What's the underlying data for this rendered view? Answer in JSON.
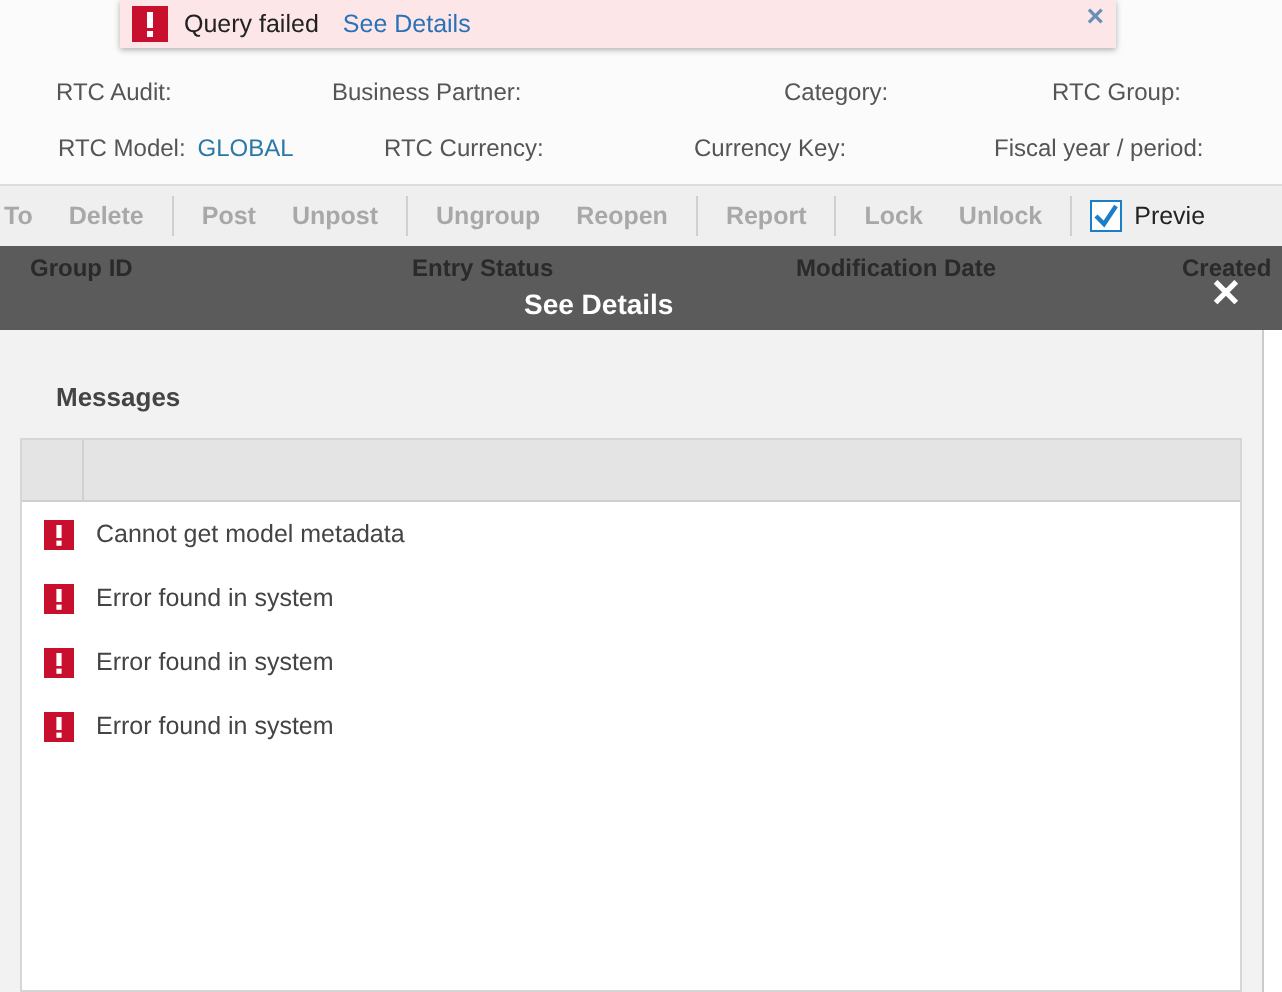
{
  "toast": {
    "message": "Query failed",
    "link": "See Details",
    "close": "×"
  },
  "filters": [
    [
      {
        "label": "RTC Audit:"
      },
      {
        "label": "Business Partner:"
      },
      {
        "label": "Category:"
      },
      {
        "label": "RTC Group:"
      }
    ],
    [
      {
        "label": "RTC Model:",
        "value": "GLOBAL"
      },
      {
        "label": "RTC Currency:"
      },
      {
        "label": "Currency Key:"
      },
      {
        "label": "Fiscal year / period:"
      }
    ]
  ],
  "toolbar": {
    "groups": [
      [
        {
          "label": "To",
          "disabled": true
        },
        {
          "label": "Delete",
          "disabled": true
        }
      ],
      [
        {
          "label": "Post",
          "disabled": true
        },
        {
          "label": "Unpost",
          "disabled": true
        }
      ],
      [
        {
          "label": "Ungroup",
          "disabled": true
        },
        {
          "label": "Reopen",
          "disabled": true
        }
      ],
      [
        {
          "label": "Report",
          "disabled": true
        }
      ],
      [
        {
          "label": "Lock",
          "disabled": true
        },
        {
          "label": "Unlock",
          "disabled": true
        }
      ]
    ],
    "checkbox": {
      "label": "Previe",
      "checked": true
    }
  },
  "table": {
    "columns": [
      "Group ID",
      "Entry Status",
      "Modification Date",
      "Created"
    ]
  },
  "dialog": {
    "title": "See Details",
    "close": "✕",
    "section": "Messages",
    "messages": [
      {
        "kind": "error",
        "text": "Cannot get model metadata"
      },
      {
        "kind": "error",
        "text": "Error found in system"
      },
      {
        "kind": "error",
        "text": "Error found in system"
      },
      {
        "kind": "error",
        "text": "Error found in system"
      }
    ]
  }
}
